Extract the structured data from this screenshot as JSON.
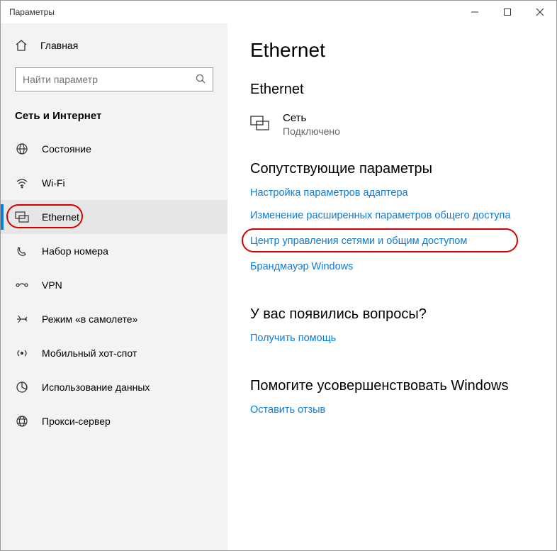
{
  "window": {
    "title": "Параметры"
  },
  "sidebar": {
    "home": "Главная",
    "search_placeholder": "Найти параметр",
    "section": "Сеть и Интернет",
    "items": [
      {
        "label": "Состояние"
      },
      {
        "label": "Wi-Fi"
      },
      {
        "label": "Ethernet"
      },
      {
        "label": "Набор номера"
      },
      {
        "label": "VPN"
      },
      {
        "label": "Режим «в самолете»"
      },
      {
        "label": "Мобильный хот-спот"
      },
      {
        "label": "Использование данных"
      },
      {
        "label": "Прокси-сервер"
      }
    ]
  },
  "main": {
    "title": "Ethernet",
    "subtitle": "Ethernet",
    "network": {
      "name": "Сеть",
      "state": "Подключено"
    },
    "related": {
      "heading": "Сопутствующие параметры",
      "links": [
        "Настройка параметров адаптера",
        "Изменение расширенных параметров общего доступа",
        "Центр управления сетями и общим доступом",
        "Брандмауэр Windows"
      ]
    },
    "questions": {
      "heading": "У вас появились вопросы?",
      "link": "Получить помощь"
    },
    "improve": {
      "heading": "Помогите усовершенствовать Windows",
      "link": "Оставить отзыв"
    }
  }
}
